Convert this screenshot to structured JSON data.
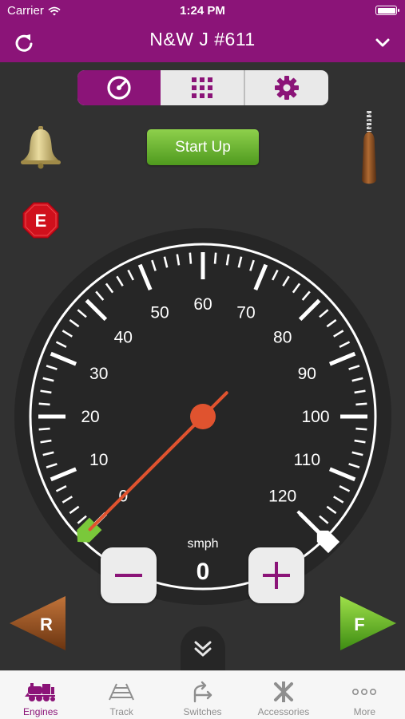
{
  "status_bar": {
    "carrier": "Carrier",
    "time": "1:24 PM"
  },
  "header": {
    "title": "N&W J #611"
  },
  "segments": [
    {
      "icon": "speedometer-icon",
      "active": true
    },
    {
      "icon": "keypad-grid-icon",
      "active": false
    },
    {
      "icon": "gear-icon",
      "active": false
    }
  ],
  "controls": {
    "startup_label": "Start Up",
    "estop_label": "E",
    "reverse_label": "R",
    "forward_label": "F"
  },
  "speedometer": {
    "min": 0,
    "max": 120,
    "current_speed": 0,
    "needle_value": 0,
    "speed_limit": 120,
    "unit": "smph",
    "tick_labels": [
      "0",
      "10",
      "20",
      "30",
      "40",
      "50",
      "60",
      "70",
      "80",
      "90",
      "100",
      "110",
      "120"
    ]
  },
  "tabbar": {
    "items": [
      {
        "label": "Engines",
        "icon": "locomotive-icon",
        "active": true
      },
      {
        "label": "Track",
        "icon": "track-icon",
        "active": false
      },
      {
        "label": "Switches",
        "icon": "switches-icon",
        "active": false
      },
      {
        "label": "Accessories",
        "icon": "accessories-icon",
        "active": false
      },
      {
        "label": "More",
        "icon": "more-dots-icon",
        "active": false
      }
    ]
  },
  "colors": {
    "brand": "#8b1478",
    "needle": "#e0532f",
    "go_green": "#6cb52e",
    "reverse_brown": "#8a4a1c",
    "stop_red": "#d0101c"
  }
}
